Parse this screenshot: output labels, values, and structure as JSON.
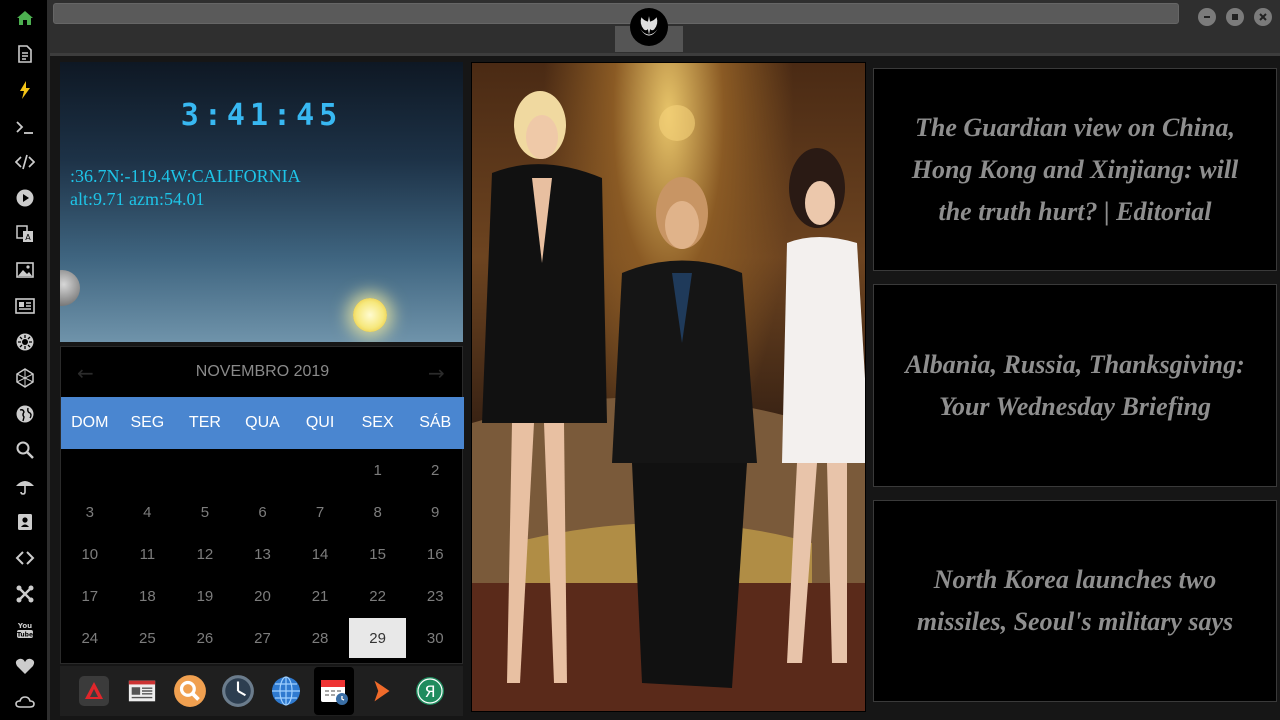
{
  "sidebar": {
    "icons": [
      "home-icon",
      "document-icon",
      "lightning-icon",
      "terminal-icon",
      "code-icon",
      "play-icon",
      "translate-icon",
      "image-icon",
      "news-icon",
      "sun-icon",
      "atom-icon",
      "globe-icon",
      "search-icon",
      "umbrella-icon",
      "contacts-icon",
      "link-icon",
      "tools-icon",
      "youtube-icon",
      "heart-icon",
      "cloud-icon"
    ],
    "youtube_label": "You Tube"
  },
  "window": {
    "logo": "rebel-alliance-logo",
    "controls": [
      "minimize",
      "maximize",
      "close"
    ]
  },
  "sky": {
    "time": "3:41:45",
    "location": ":36.7N:-119.4W:CALIFORNIA",
    "sun_position": "alt:9.71 azm:54.01"
  },
  "calendar": {
    "month_label": "NOVEMBRO 2019",
    "prev": "←",
    "next": "→",
    "weekdays": [
      "DOM",
      "SEG",
      "TER",
      "QUA",
      "QUI",
      "SEX",
      "SÁB"
    ],
    "days": [
      "",
      "",
      "",
      "",
      "",
      "1",
      "2",
      "3",
      "4",
      "5",
      "6",
      "7",
      "8",
      "9",
      "10",
      "11",
      "12",
      "13",
      "14",
      "15",
      "16",
      "17",
      "18",
      "19",
      "20",
      "21",
      "22",
      "23",
      "24",
      "25",
      "26",
      "27",
      "28",
      "29",
      "30"
    ],
    "today": "29"
  },
  "dock": {
    "apps": [
      "app-launcher-icon",
      "news-reader-icon",
      "search-app-icon",
      "clock-app-icon",
      "browser-globe-icon",
      "calendar-app-icon",
      "arrow-app-icon",
      "yandex-icon"
    ],
    "yandex_letter": "Я"
  },
  "news": [
    "The Guardian view on China, Hong Kong and Xinjiang: will the truth hurt? | Editorial",
    "Albania, Russia, Thanksgiving: Your Wednesday Briefing",
    "North Korea launches two missiles, Seoul's military says"
  ],
  "colors": {
    "accent_blue": "#4a86d0",
    "clock_cyan": "#38b8f2",
    "sky_text": "#1ec5e8",
    "sidebar_home": "#4caf50",
    "sidebar_bolt": "#f5c518"
  }
}
